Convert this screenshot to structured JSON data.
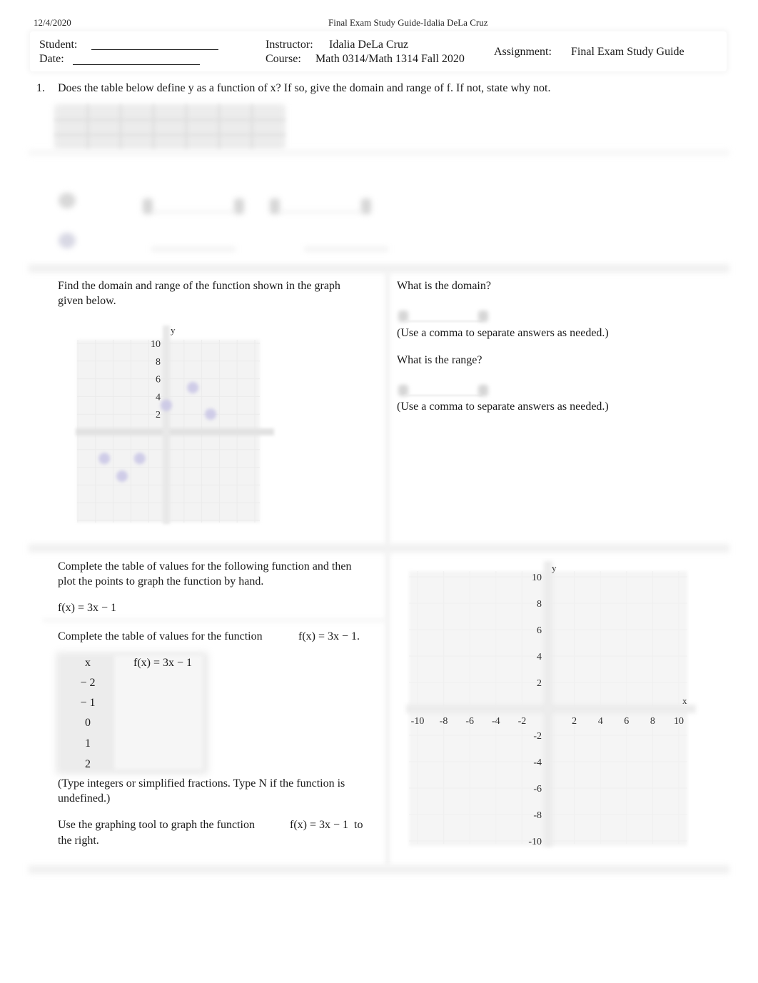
{
  "page_header": {
    "date": "12/4/2020",
    "title": "Final Exam Study Guide-Idalia DeLa Cruz"
  },
  "info": {
    "student_label": "Student:",
    "student_value": "",
    "date_label": "Date:",
    "date_value": "",
    "instructor_label": "Instructor:",
    "instructor_value": "Idalia DeLa Cruz",
    "course_label": "Course:",
    "course_value": "Math 0314/Math 1314 Fall 2020",
    "assignment_label": "Assignment:",
    "assignment_value": "Final Exam Study Guide"
  },
  "q1": {
    "number": "1.",
    "prompt": "Does the table below define y as a function of x? If so, give the domain and range of f. If not, state why not."
  },
  "q2": {
    "prompt": "Find the domain and range of the function shown in the graph given below.",
    "domain_question": "What is the domain?",
    "domain_answer": "",
    "domain_hint": "(Use a comma to separate answers as needed.)",
    "range_question": "What is the range?",
    "range_answer": "",
    "range_hint": "(Use a comma to separate answers as needed.)"
  },
  "q3": {
    "prompt": "Complete the table of values for the following function and then plot the points to graph the function by hand.",
    "function": "f(x) = 3x − 1",
    "table_prompt": "Complete the table of values for the function",
    "table_function": "f(x) = 3x − 1.",
    "table": {
      "headers": [
        "x",
        "f(x) = 3x − 1"
      ],
      "rows": [
        {
          "x": "− 2",
          "fx": ""
        },
        {
          "x": "− 1",
          "fx": ""
        },
        {
          "x": "0",
          "fx": ""
        },
        {
          "x": "1",
          "fx": ""
        },
        {
          "x": "2",
          "fx": ""
        }
      ]
    },
    "table_hint": "(Type integers or simplified fractions. Type N if the function is undefined.)",
    "graph_prompt_a": "Use the graphing tool to graph the function",
    "graph_function": "f(x) = 3x − 1",
    "graph_prompt_b": "to",
    "graph_prompt_c": "the right."
  },
  "chart_data": [
    {
      "type": "scatter",
      "title": "",
      "xlabel": "",
      "ylabel": "y",
      "xlim": [
        -10,
        10
      ],
      "ylim": [
        -10,
        10
      ],
      "y_tick_labels": [
        "10",
        "8",
        "6",
        "4",
        "2"
      ],
      "y_ticks": [
        10,
        8,
        6,
        4,
        2
      ],
      "grid": true,
      "points": [
        {
          "x": 0,
          "y": 3
        },
        {
          "x": 3,
          "y": 5
        },
        {
          "x": 5,
          "y": 2
        },
        {
          "x": -7,
          "y": -3
        },
        {
          "x": -3,
          "y": -3
        },
        {
          "x": -5,
          "y": -5
        }
      ],
      "point_color": "#c9c6e6"
    },
    {
      "type": "scatter",
      "title": "",
      "xlabel": "x",
      "ylabel": "y",
      "xlim": [
        -10,
        10
      ],
      "ylim": [
        -10,
        10
      ],
      "x_ticks": [
        -10,
        -8,
        -6,
        -4,
        -2,
        2,
        4,
        6,
        8,
        10
      ],
      "x_tick_labels": [
        "-10",
        "-8",
        "-6",
        "-4",
        "-2",
        "2",
        "4",
        "6",
        "8",
        "10"
      ],
      "y_ticks": [
        10,
        8,
        6,
        4,
        2,
        -2,
        -4,
        -6,
        -8,
        -10
      ],
      "y_tick_labels": [
        "10",
        "8",
        "6",
        "4",
        "2",
        "-2",
        "-4",
        "-6",
        "-8",
        "-10"
      ],
      "grid": true,
      "points": []
    }
  ]
}
